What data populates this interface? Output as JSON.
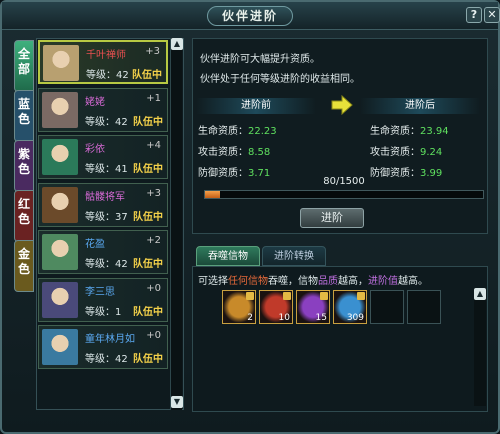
{
  "window": {
    "title": "伙伴进阶",
    "help_label": "?",
    "close_label": "✕"
  },
  "tabs": [
    {
      "label": "全部",
      "color": "#2f8f6a"
    },
    {
      "label": "蓝色",
      "color": "#26506a"
    },
    {
      "label": "紫色",
      "color": "#4a2a60"
    },
    {
      "label": "红色",
      "color": "#6a2222"
    },
    {
      "label": "金色",
      "color": "#6a5a1e"
    }
  ],
  "partners": [
    {
      "name": "千叶禅师",
      "name_color": "#e85050",
      "plus": "+3",
      "level": "等级：42",
      "status": "队伍中",
      "avatar_color": "#b8a070"
    },
    {
      "name": "姥姥",
      "name_color": "#d76ad6",
      "plus": "+1",
      "level": "等级：42",
      "status": "队伍中",
      "avatar_color": "#7b6a64"
    },
    {
      "name": "彩依",
      "name_color": "#d76ad6",
      "plus": "+4",
      "level": "等级：41",
      "status": "队伍中",
      "avatar_color": "#2b7a5a"
    },
    {
      "name": "骷髅将军",
      "name_color": "#d76ad6",
      "plus": "+3",
      "level": "等级：37",
      "status": "队伍中",
      "avatar_color": "#6b4a2a"
    },
    {
      "name": "花盈",
      "name_color": "#5aa8f0",
      "plus": "+2",
      "level": "等级：42",
      "status": "队伍中",
      "avatar_color": "#4f8a60"
    },
    {
      "name": "李三思",
      "name_color": "#5aa8f0",
      "plus": "+0",
      "level": "等级：1",
      "status": "队伍中",
      "avatar_color": "#4a4a7a"
    },
    {
      "name": "童年林月如",
      "name_color": "#5aa8f0",
      "plus": "+0",
      "level": "等级：42",
      "status": "队伍中",
      "avatar_color": "#3a7aa0"
    }
  ],
  "info": {
    "line1": "伙伴进阶可大幅提升资质。",
    "line2": "伙伴处于任何等级进阶的收益相同。",
    "before_label": "进阶前",
    "after_label": "进阶后",
    "stats_before": [
      {
        "label": "生命资质：",
        "value": "22.23"
      },
      {
        "label": "攻击资质：",
        "value": "8.58"
      },
      {
        "label": "防御资质：",
        "value": "3.71"
      }
    ],
    "stats_after": [
      {
        "label": "生命资质：",
        "value": "23.94"
      },
      {
        "label": "攻击资质：",
        "value": "9.24"
      },
      {
        "label": "防御资质：",
        "value": "3.99"
      }
    ],
    "progress_text": "80/1500",
    "progress_fraction": 0.053,
    "advance_label": "进阶"
  },
  "bottom": {
    "tab_active": "吞噬信物",
    "tab_inactive": "进阶转换",
    "desc_part1": "可选择",
    "desc_part2": "任何信物",
    "desc_part3": "吞噬，信物",
    "desc_part4": "品质",
    "desc_part5": "越高，",
    "desc_part6": "进阶值",
    "desc_part7": "越高。",
    "items": [
      {
        "count": "2",
        "color": "#c88a2a",
        "icon": "gem-icon"
      },
      {
        "count": "10",
        "color": "#c03a2a",
        "icon": "flame-icon"
      },
      {
        "count": "15",
        "color": "#8a40c0",
        "icon": "spiral-icon"
      },
      {
        "count": "309",
        "color": "#3a90d0",
        "icon": "crystal-icon"
      }
    ]
  }
}
